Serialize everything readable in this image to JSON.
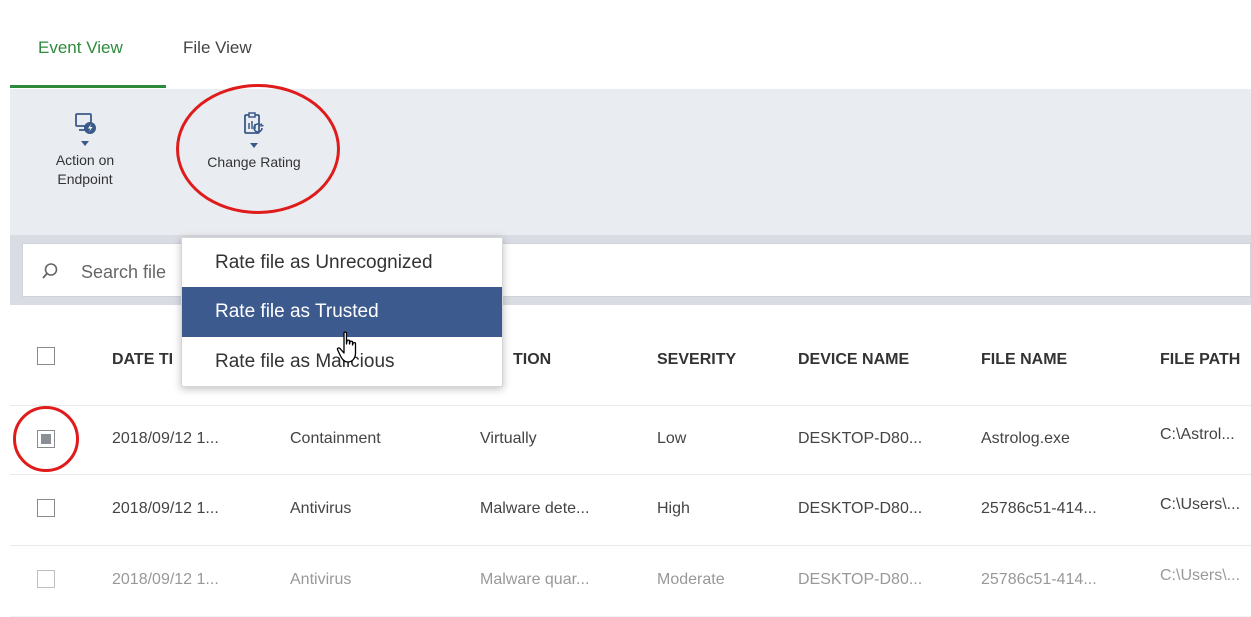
{
  "tabs": [
    {
      "label": "Event View",
      "active": true
    },
    {
      "label": "File View",
      "active": false
    }
  ],
  "toolbar": {
    "action_label_line1": "Action on",
    "action_label_line2": "Endpoint",
    "change_rating_label": "Change Rating",
    "action_icon": "monitor-lightning-icon",
    "change_rating_icon": "clipboard-refresh-icon"
  },
  "search": {
    "placeholder": "Search file"
  },
  "dropdown": {
    "items": [
      {
        "label": "Rate file as Unrecognized",
        "highlighted": false
      },
      {
        "label": "Rate file as Trusted",
        "highlighted": true
      },
      {
        "label": "Rate file as Malicious",
        "highlighted": false
      }
    ]
  },
  "table": {
    "headers": [
      "DATE TIME",
      "ACTION",
      "SEVERITY",
      "DEVICE NAME",
      "FILE NAME",
      "FILE PATH"
    ],
    "header_visible": {
      "date": "DATE TI",
      "action": "TION",
      "severity": "SEVERITY",
      "device": "DEVICE NAME",
      "file": "FILE NAME",
      "path": "FILE PATH"
    },
    "rows": [
      {
        "checked": true,
        "date": "2018/09/12 1...",
        "source": "Containment",
        "action": "Virtually",
        "severity": "Low",
        "device": "DESKTOP-D80...",
        "file": "Astrolog.exe",
        "path": "C:\\Astrol..."
      },
      {
        "checked": false,
        "date": "2018/09/12 1...",
        "source": "Antivirus",
        "action": "Malware dete...",
        "severity": "High",
        "device": "DESKTOP-D80...",
        "file": "25786c51-414...",
        "path": "C:\\Users\\..."
      },
      {
        "checked": false,
        "date": "2018/09/12 1...",
        "source": "Antivirus",
        "action": "Malware quar...",
        "severity": "Moderate",
        "device": "DESKTOP-D80...",
        "file": "25786c51-414...",
        "path": "C:\\Users\\..."
      }
    ]
  },
  "colors": {
    "accent_green": "#2d8a3c",
    "highlight_blue": "#3d5a8f",
    "annotation_red": "#e01b1b"
  }
}
